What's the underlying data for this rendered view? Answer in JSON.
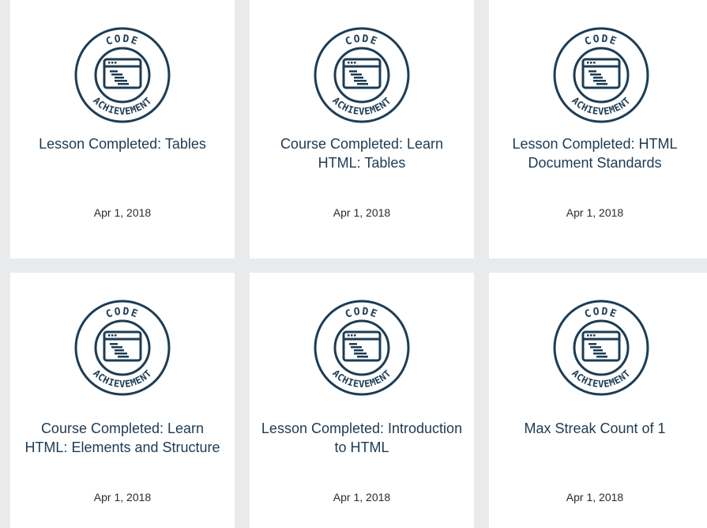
{
  "badge": {
    "top_word": "CODE",
    "bottom_word": "ACHIEVEMENT",
    "color": "#1d3c54"
  },
  "cards": [
    {
      "title": "Lesson Completed: Tables",
      "date": "Apr 1, 2018"
    },
    {
      "title": "Course Completed: Learn HTML: Tables",
      "date": "Apr 1, 2018"
    },
    {
      "title": "Lesson Completed: HTML Document Standards",
      "date": "Apr 1, 2018"
    },
    {
      "title": "Course Completed: Learn HTML: Elements and Structure",
      "date": "Apr 1, 2018"
    },
    {
      "title": "Lesson Completed: Introduction to HTML",
      "date": "Apr 1, 2018"
    },
    {
      "title": "Max Streak Count of 1",
      "date": "Apr 1, 2018"
    }
  ]
}
